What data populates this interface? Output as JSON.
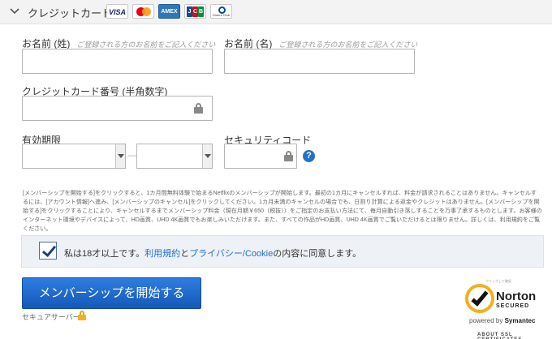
{
  "header": {
    "title": "クレジットカード",
    "toggle_icon": "chevron-down-icon",
    "card_brands": {
      "visa": "VISA",
      "amex": "AMEX",
      "jcb": [
        "J",
        "C",
        "B"
      ],
      "diners": "Diners Club"
    }
  },
  "form": {
    "last_name": {
      "label": "お名前 (姓)",
      "hint": "ご登録される方のお名前をご記入ください",
      "value": ""
    },
    "first_name": {
      "label": "お名前 (名)",
      "hint": "ご登録される方のお名前をご記入ください",
      "value": ""
    },
    "card_number": {
      "label": "クレジットカード番号 (半角数字)",
      "value": "",
      "icon": "lock-icon"
    },
    "expiry": {
      "label": "有効期限",
      "month_value": "",
      "year_value": "",
      "separator": "—"
    },
    "security_code": {
      "label": "セキュリティコード",
      "value": "",
      "icon": "lock-icon",
      "help": "?"
    }
  },
  "terms_text": "[メンバーシップを開始する]をクリックすると、1カ月間無料体験で始まるNetflixのメンバーシップが開始します。最初の1カ月にキャンセルすれば、料金が請求されることはありません。キャンセルするには、[アカウント情報]へ進み、[メンバーシップのキャンセル]をクリックしてください。1カ月未満のキャンセルの場合でも、日割り計算による返金やクレジットはありません。[メンバーシップを開始する]をクリックすることにより、キャンセルするまでメンバーシップ料金（現在月額￥650（税抜））をご指定のお支払い方法にて、毎月自動引き落しすることを万事了承するものとします。お客様のインターネット環境やデバイスによって、HD画質、UHD 4K画質でもお楽しみいただけます。また、すべての作品がHD画質、UHD 4K画質でご覧いただけるとは限りません。詳しくは、利用規約をご覧ください。",
  "agreement": {
    "checked": true,
    "text_before": "私は18才以上です。",
    "terms_link": "利用規約",
    "connector": "と",
    "privacy_link": "プライバシー/Cookie",
    "text_after": "の内容に同意します。"
  },
  "submit": {
    "label": "メンバーシップを開始する"
  },
  "secure_server": {
    "label": "セキュアサーバー",
    "icon": "lock-icon"
  },
  "norton_badge": {
    "top_text": "クリックして確認",
    "name": "Norton",
    "secured": "SECURED",
    "powered_by": "powered by",
    "vendor": "Symantec",
    "bottom_text": "ABOUT SSL CERTIFICATES"
  },
  "colors": {
    "primary_button": "#1f6fd1",
    "link": "#1f6fd1",
    "header_bg": "#f3f3f3",
    "agree_bg": "#eef1f6",
    "norton_yellow": "#f2b01e"
  }
}
